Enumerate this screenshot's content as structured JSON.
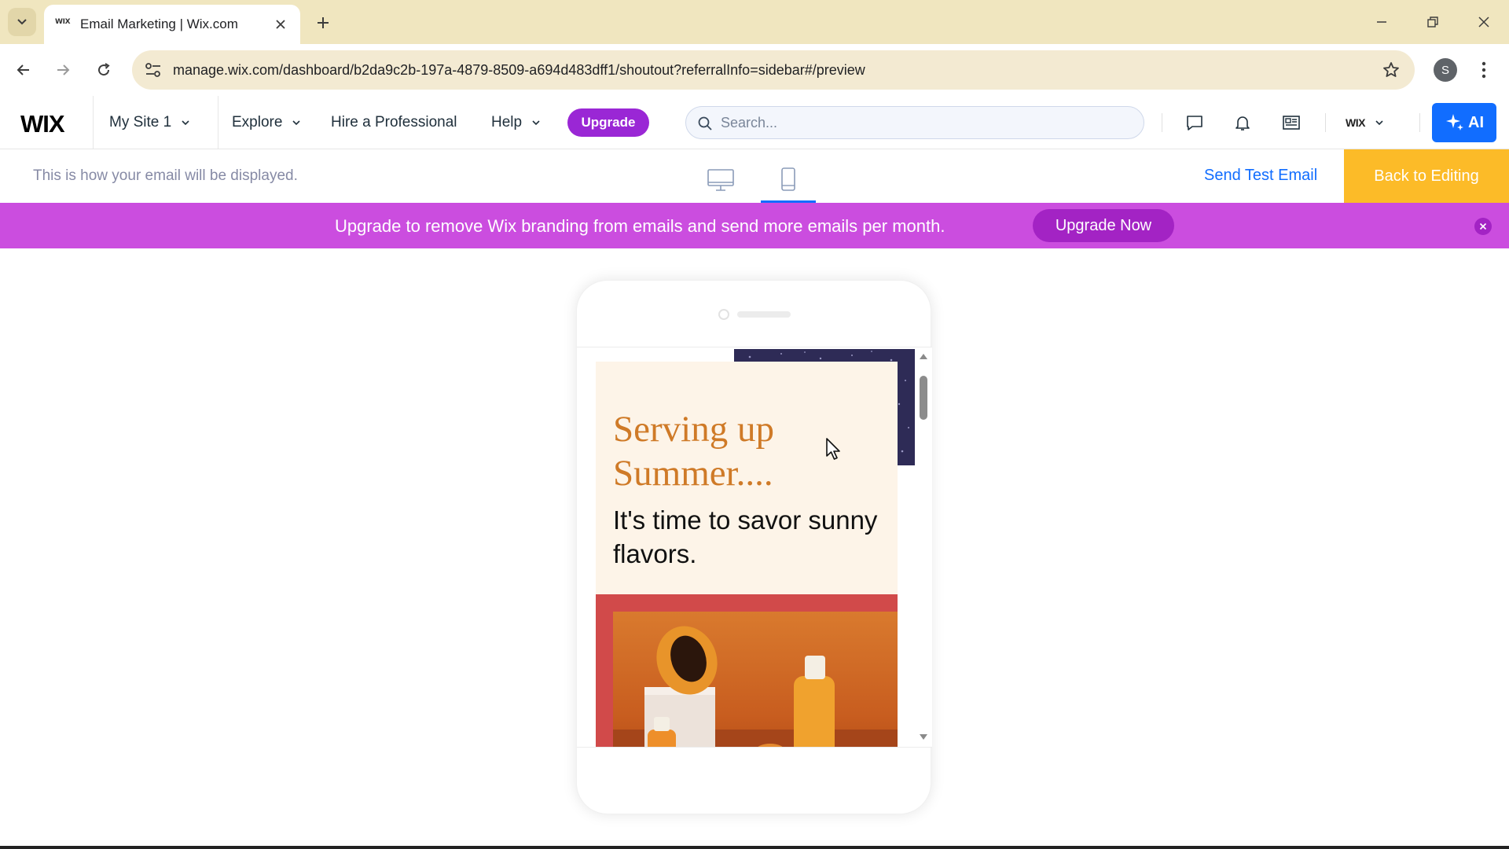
{
  "browser": {
    "tab_title": "Email Marketing | Wix.com",
    "tab_favicon_text": "WIX",
    "url": "manage.wix.com/dashboard/b2da9c2b-197a-4879-8509-a694d483dff1/shoutout?referralInfo=sidebar#/preview",
    "profile_initial": "S"
  },
  "wix_topbar": {
    "logo": "WIX",
    "site_name": "My Site 1",
    "menu": {
      "explore": "Explore",
      "hire": "Hire a Professional",
      "help": "Help"
    },
    "upgrade_label": "Upgrade",
    "search_placeholder": "Search...",
    "account_label": "WIX",
    "ai_label": "AI"
  },
  "preview": {
    "hint": "This is how your email will be displayed.",
    "active_view": "mobile",
    "send_test_label": "Send Test Email",
    "back_label": "Back to Editing"
  },
  "banner": {
    "text": "Upgrade to remove Wix branding from emails and send more emails per month.",
    "button_label": "Upgrade Now"
  },
  "email": {
    "title": "Serving up Summer....",
    "subtitle": "It's time to savor sunny flavors."
  },
  "colors": {
    "accent_blue": "#116dff",
    "upgrade_purple": "#9a27d5",
    "banner_magenta": "#cb4ddf",
    "back_button_yellow": "#fcbb28",
    "email_title_orange": "#cf7a27",
    "email_navy": "#2e2b56"
  },
  "icons": {
    "tab_list": "chevron-down-icon",
    "tab_close": "close-icon",
    "new_tab": "plus-icon",
    "back": "arrow-left-icon",
    "forward": "arrow-right-icon",
    "reload": "reload-icon",
    "site_info": "tune-icon",
    "bookmark": "star-icon",
    "menu": "kebab-icon",
    "search": "search-icon",
    "chat": "chat-icon",
    "notifications": "bell-icon",
    "apps": "newspaper-icon",
    "ai": "sparkle-icon",
    "desktop_view": "monitor-icon",
    "mobile_view": "phone-icon"
  }
}
